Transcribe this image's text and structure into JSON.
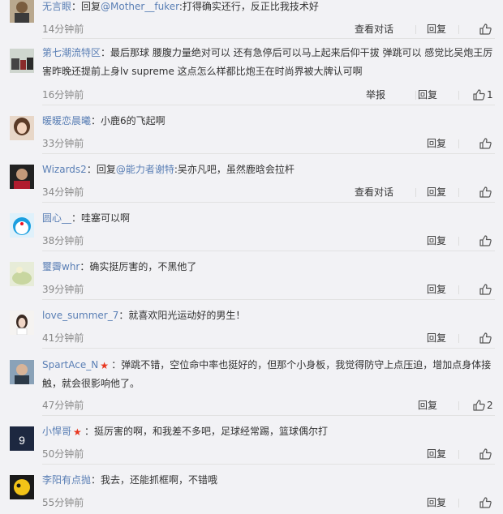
{
  "labels": {
    "view": "查看对话",
    "report": "举报",
    "reply": "回复"
  },
  "comments": [
    {
      "nick": "无言眼",
      "body": [
        {
          "t": "：回复"
        },
        {
          "t": "@Mother__fuker",
          "at": true
        },
        {
          "t": ":打得确实还行，反正比我技术好"
        }
      ],
      "time": "14分钟前",
      "view": true,
      "report": false,
      "likes": ""
    },
    {
      "nick": "第七潮流特区",
      "body": [
        {
          "t": "：最后那球 腰腹力量绝对可以 还有急停后可以马上起来后仰干拔 弹跳可以 感觉比吴炮王厉害昨晚还提前上身lv supreme 这点怎么样都比炮王在时尚界被大牌认可啊"
        }
      ],
      "time": "16分钟前",
      "view": false,
      "report": true,
      "likes": "1"
    },
    {
      "nick": "暖暖恋晨曦",
      "body": [
        {
          "t": "：小鹿6的飞起啊"
        }
      ],
      "time": "33分钟前",
      "view": false,
      "report": false,
      "likes": ""
    },
    {
      "nick": "Wizards2",
      "body": [
        {
          "t": "：回复"
        },
        {
          "t": "@能力者谢特",
          "at": true
        },
        {
          "t": ":吴亦凡吧，虽然鹿晗会拉杆"
        }
      ],
      "time": "34分钟前",
      "view": true,
      "report": false,
      "likes": ""
    },
    {
      "nick": "圆心__",
      "body": [
        {
          "t": "：哇塞可以啊"
        }
      ],
      "time": "38分钟前",
      "view": false,
      "report": false,
      "likes": ""
    },
    {
      "nick": "璽霽whr",
      "body": [
        {
          "t": "：确实挺厉害的，不黑他了"
        }
      ],
      "time": "39分钟前",
      "view": false,
      "report": false,
      "likes": ""
    },
    {
      "nick": "love_summer_7",
      "body": [
        {
          "t": "：就喜欢阳光运动好的男生！"
        }
      ],
      "time": "41分钟前",
      "view": false,
      "report": false,
      "likes": ""
    },
    {
      "nick": "SpartAce_N",
      "vip": true,
      "body": [
        {
          "t": "：弹跳不错，空位命中率也挺好的，但那个小身板，我觉得防守上点压迫，增加点身体接触，就会很影响他了。"
        }
      ],
      "time": "47分钟前",
      "view": false,
      "report": false,
      "likes": "2"
    },
    {
      "nick": "小悍哥",
      "vip": true,
      "body": [
        {
          "t": "：挺厉害的啊，和我差不多吧，足球经常踢，篮球偶尔打"
        }
      ],
      "time": "50分钟前",
      "view": false,
      "report": false,
      "likes": ""
    },
    {
      "nick": "李阳有点抛",
      "body": [
        {
          "t": "：我去，还能抓框啊，不错哦"
        }
      ],
      "time": "55分钟前",
      "view": false,
      "report": false,
      "likes": ""
    }
  ]
}
